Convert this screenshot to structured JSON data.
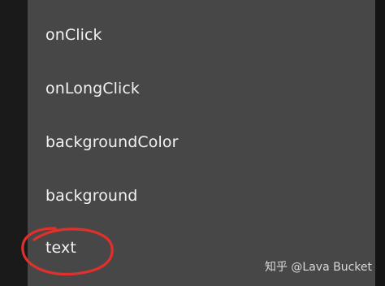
{
  "menu": {
    "items": [
      {
        "label": "onClick"
      },
      {
        "label": "onLongClick"
      },
      {
        "label": "backgroundColor"
      },
      {
        "label": "background"
      },
      {
        "label": "text"
      }
    ]
  },
  "annotation": {
    "shape": "hand-drawn circle around text",
    "color": "#e0302c"
  },
  "watermark": {
    "text": "知乎 @Lava Bucket"
  },
  "colors": {
    "panel": "#474747",
    "background": "#111111",
    "text": "#f2f2f2"
  }
}
